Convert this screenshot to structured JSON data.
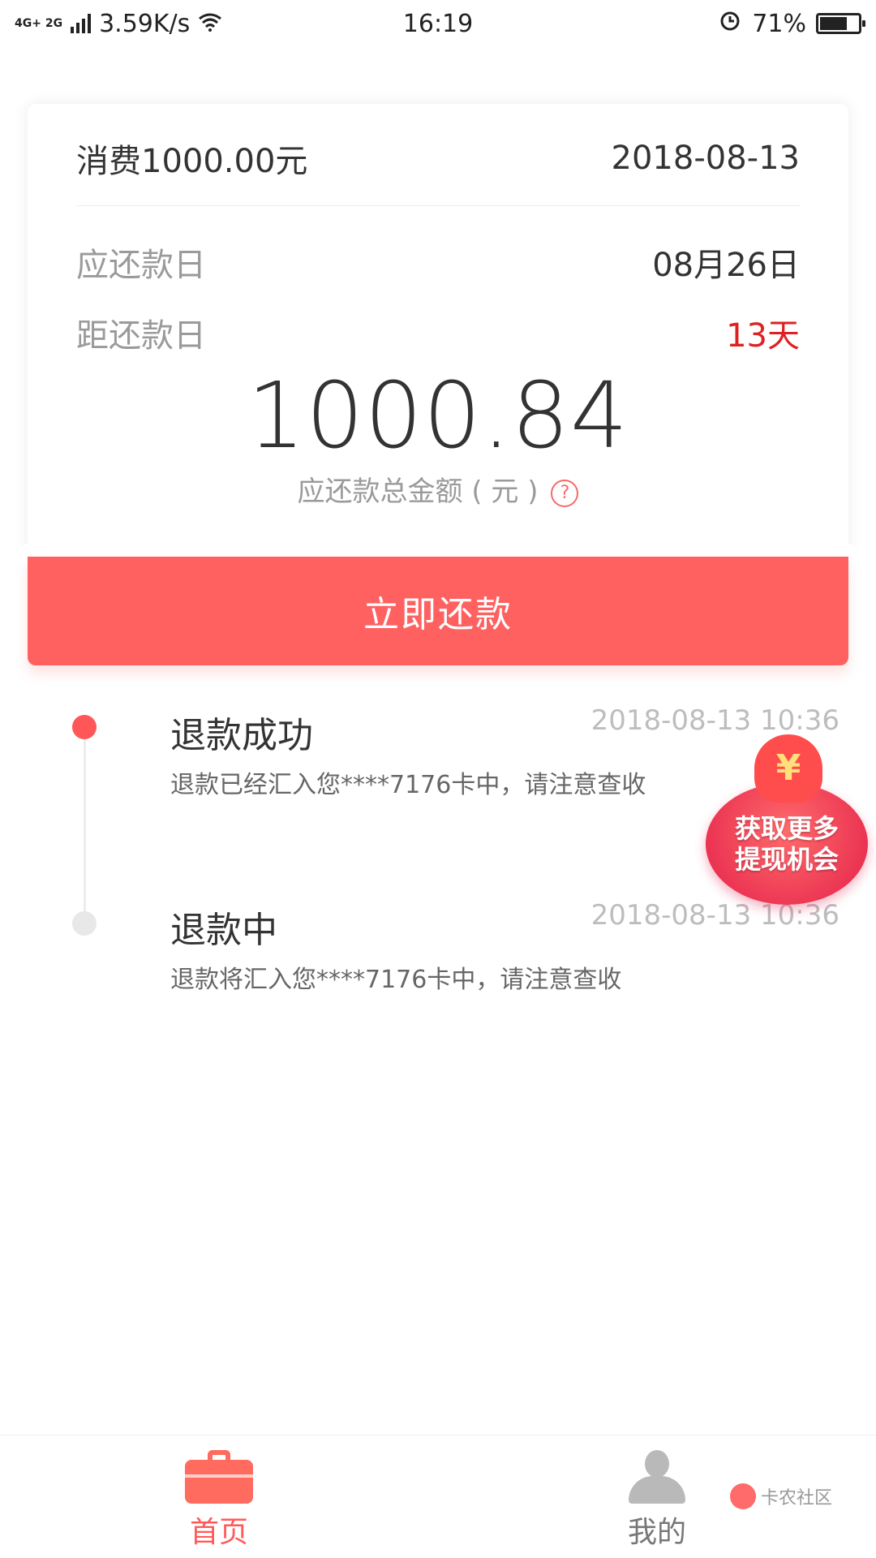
{
  "status_bar": {
    "network": "4G+ 2G",
    "speed": "3.59K/s",
    "time": "16:19",
    "battery": "71%",
    "battery_level": 0.71,
    "icons": [
      "signal-icon",
      "wifi-icon",
      "alarm-icon",
      "battery-icon"
    ]
  },
  "bill": {
    "title": "消费1000.00元",
    "date": "2018-08-13",
    "due_label": "应还款日",
    "due_value": "08月26日",
    "days_label": "距还款日",
    "days_value": "13天",
    "amount": "1000.84",
    "amount_caption": "应还款总金额 ( 元 )",
    "help_icon": "?"
  },
  "pay_button": {
    "label": "立即还款"
  },
  "timeline": [
    {
      "title": "退款成功",
      "time": "2018-08-13 10:36",
      "desc": "退款已经汇入您****7176卡中，请注意查收",
      "state": "active"
    },
    {
      "title": "退款中",
      "time": "2018-08-13 10:36",
      "desc": "退款将汇入您****7176卡中，请注意查收",
      "state": "inactive"
    }
  ],
  "promo": {
    "symbol": "¥",
    "line1": "获取更多",
    "line2": "提现机会"
  },
  "bottom_nav": {
    "items": [
      {
        "label": "首页",
        "icon": "briefcase-icon",
        "active": true
      },
      {
        "label": "我的",
        "icon": "person-icon",
        "active": false
      }
    ]
  },
  "watermark": {
    "text": "卡农社区"
  },
  "colors": {
    "accent": "#ff6161",
    "warning_red": "#e02020",
    "muted": "#9a9a9a"
  }
}
